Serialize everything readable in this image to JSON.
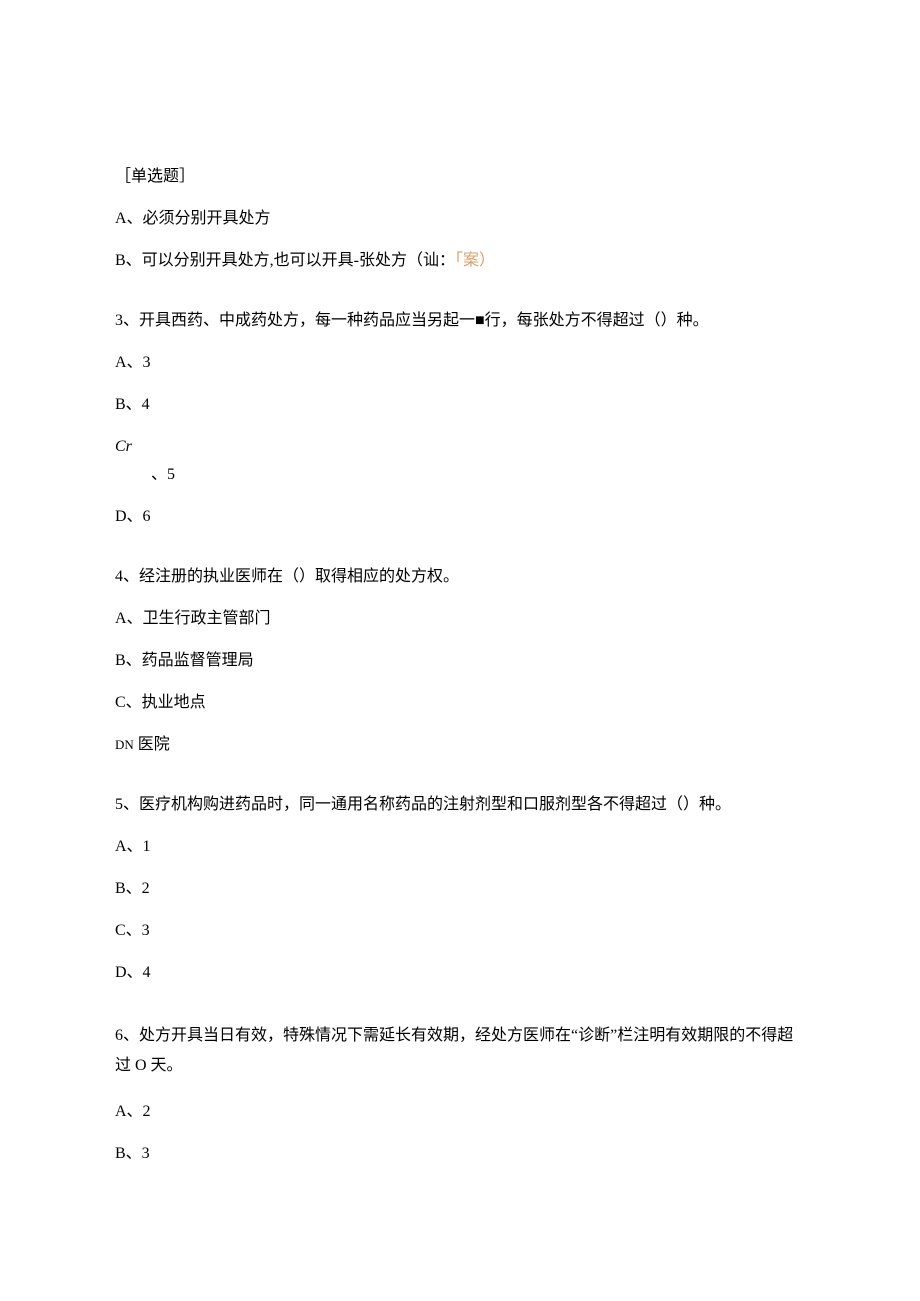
{
  "header": {
    "tag": "［单选题］"
  },
  "q2": {
    "optA": "A、必须分别开具处方",
    "optB_prefix": "B、可以分别开具处方,也可以开具-张处方（讪：",
    "optB_answer": "「案）"
  },
  "q3": {
    "text": "3、开具西药、中成药处方，每一种药品应当另起一■行，每张处方不得超过（）种。",
    "optA": "A、3",
    "optB": "B、4",
    "optC_label": "Cr",
    "optC_val": "、5",
    "optD": "D、6"
  },
  "q4": {
    "text": "4、经注册的执业医师在（）取得相应的处方权。",
    "optA": "A、卫生行政主管部门",
    "optB": "B、药品监督管理局",
    "optC": "C、执业地点",
    "optD_label": "DN",
    "optD_val": " 医院"
  },
  "q5": {
    "text": "5、医疗机构购进药品时，同一通用名称药品的注射剂型和口服剂型各不得超过（）种。",
    "optA": "A、1",
    "optB": "B、2",
    "optC": "C、3",
    "optD": "D、4"
  },
  "q6": {
    "text": "6、处方开具当日有效，特殊情况下需延长有效期，经处方医师在“诊断”栏注明有效期限的不得超过 O 天。",
    "optA": "A、2",
    "optB": "B、3"
  }
}
